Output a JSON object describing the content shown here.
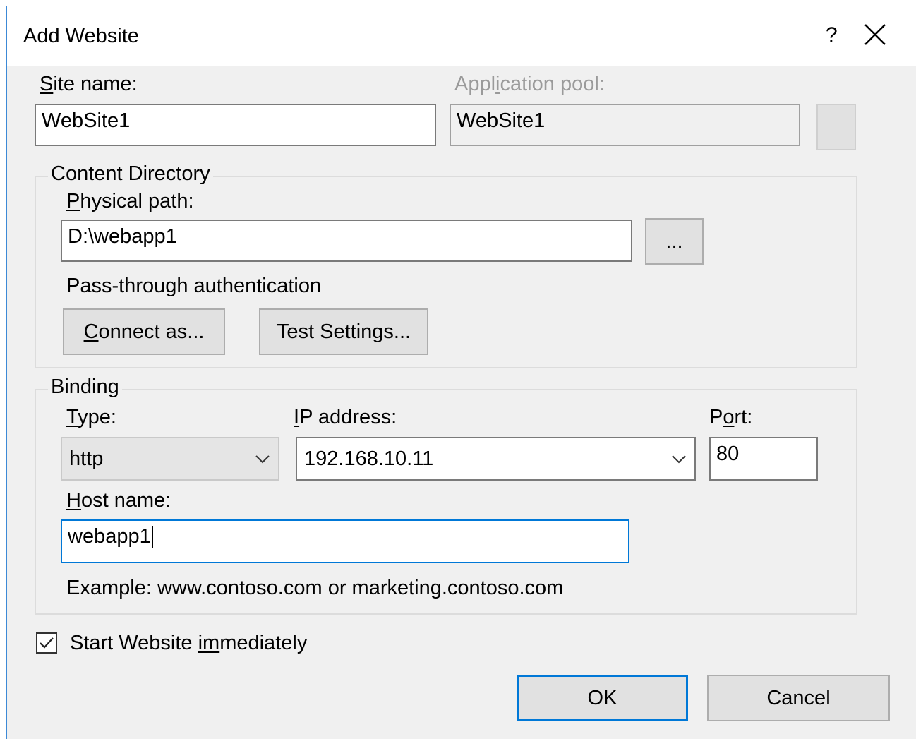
{
  "dialog": {
    "title": "Add Website",
    "help_icon": "?",
    "close_icon": "close-icon"
  },
  "site": {
    "label": "Site name:",
    "value": "WebSite1"
  },
  "app_pool": {
    "label": "Application pool:",
    "value": "WebSite1"
  },
  "content": {
    "group_title": "Content Directory",
    "physical_path_label": "Physical path:",
    "physical_path_value": "D:\\webapp1",
    "browse_label": "...",
    "passthrough_label": "Pass-through authentication",
    "connect_as_label": "Connect as...",
    "test_settings_label": "Test Settings..."
  },
  "binding": {
    "group_title": "Binding",
    "type_label": "Type:",
    "type_value": "http",
    "ip_label": "IP address:",
    "ip_value": "192.168.10.11",
    "port_label": "Port:",
    "port_value": "80",
    "host_label": "Host name:",
    "host_value": "webapp1",
    "example": "Example: www.contoso.com or marketing.contoso.com"
  },
  "start": {
    "label": "Start Website immediately",
    "checked": true
  },
  "footer": {
    "ok_label": "OK",
    "cancel_label": "Cancel"
  },
  "colors": {
    "accent": "#0078d7",
    "window_bg": "#f0f0f0"
  }
}
